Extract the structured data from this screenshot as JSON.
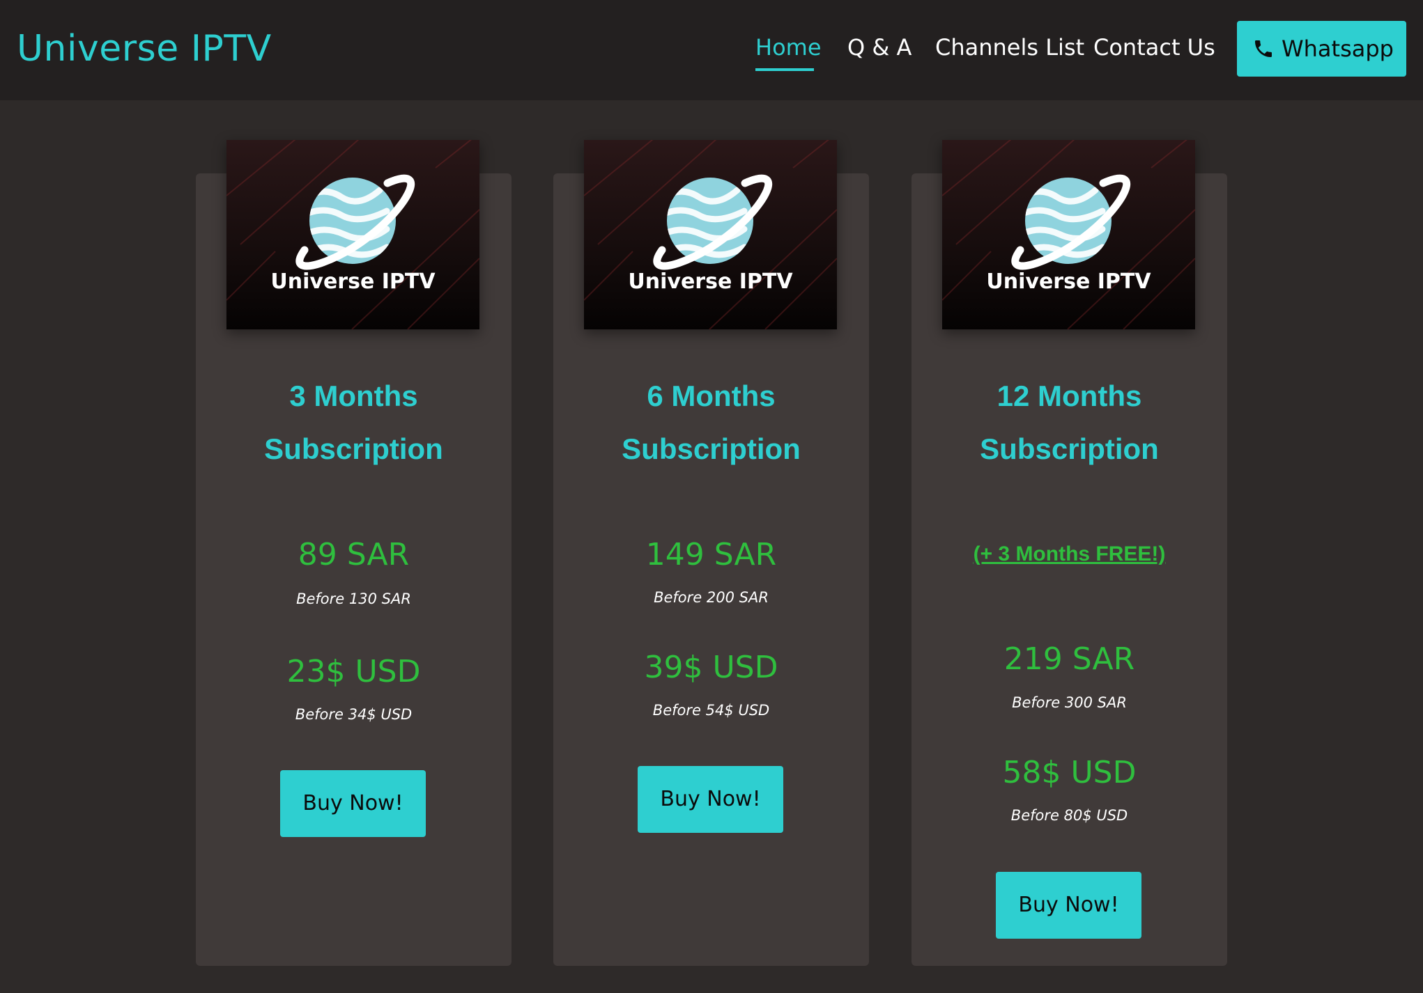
{
  "header": {
    "brand": "Universe IPTV",
    "nav": [
      {
        "label": "Home",
        "active": true
      },
      {
        "label": "Q & A",
        "active": false
      },
      {
        "label": "Channels List",
        "active": false
      },
      {
        "label": "Contact Us",
        "active": false
      }
    ],
    "whatsapp": {
      "label": "Whatsapp",
      "icon": "phone-icon"
    }
  },
  "logo": {
    "text": "Universe IPTV",
    "icon": "planet-logo-icon"
  },
  "colors": {
    "accent": "#2ecfd0",
    "price_green": "#2fbf3e",
    "page_bg": "#2e2a29",
    "header_bg": "#232020",
    "card_bg": "#403a39"
  },
  "plans": [
    {
      "title_line1": "3 Months",
      "title_line2": "Subscription",
      "price_sar": "89 SAR",
      "before_sar": "Before 130 SAR",
      "price_usd": "23$ USD",
      "before_usd": "Before 34$ USD",
      "button": "Buy Now!"
    },
    {
      "title_line1": "6 Months",
      "title_line2": "Subscription",
      "price_sar": "149 SAR",
      "before_sar": "Before 200 SAR",
      "price_usd": "39$ USD",
      "before_usd": "Before 54$ USD",
      "button": "Buy Now!"
    },
    {
      "title_line1": "12 Months",
      "title_line2": "Subscription",
      "bonus": "(+ 3 Months FREE!)",
      "price_sar": "219 SAR",
      "before_sar": "Before 300 SAR",
      "price_usd": "58$ USD",
      "before_usd": "Before 80$ USD",
      "button": "Buy Now!"
    }
  ]
}
